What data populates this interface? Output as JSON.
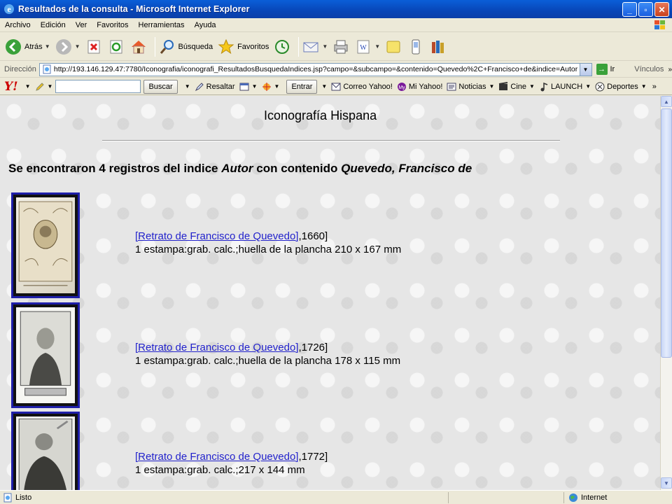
{
  "window": {
    "title": "Resultados de la consulta - Microsoft Internet Explorer"
  },
  "menu": [
    "Archivo",
    "Edición",
    "Ver",
    "Favoritos",
    "Herramientas",
    "Ayuda"
  ],
  "toolbar": {
    "back_label": "Atrás",
    "search_label": "Búsqueda",
    "favorites_label": "Favoritos"
  },
  "address": {
    "label": "Dirección",
    "url": "http://193.146.129.47:7780/Iconografia/iconografi_ResultadosBusquedaIndices.jsp?campo=&subcampo=&contenido=Quevedo%2C+Francisco+de&indice=Autor",
    "go_label": "Ir",
    "links_label": "Vínculos"
  },
  "yahoo": {
    "logo": "Y!",
    "search_button": "Buscar",
    "highlight": "Resaltar",
    "enter": "Entrar",
    "mail": "Correo Yahoo!",
    "my_yahoo": "Mi Yahoo!",
    "news": "Noticias",
    "cinema": "Cine",
    "launch": "LAUNCH",
    "sports": "Deportes"
  },
  "page": {
    "title": "Iconografía Hispana",
    "summary_prefix": "Se encontraron 4 registros del indice ",
    "summary_index": "Autor",
    "summary_mid": " con contenido ",
    "summary_value": "Quevedo, Francisco de",
    "records": [
      {
        "link": "[Retrato de Francisco de Quevedo]",
        "year": ",1660]",
        "desc": "1 estampa:grab. calc.;huella de la plancha 210 x 167 mm"
      },
      {
        "link": "[Retrato de Francisco de Quevedo]",
        "year": ",1726]",
        "desc": "1 estampa:grab. calc.;huella de la plancha 178 x 115 mm"
      },
      {
        "link": "[Retrato de Francisco de Quevedo]",
        "year": ",1772]",
        "desc": "1 estampa:grab. calc.;217 x 144 mm"
      }
    ]
  },
  "status": {
    "text": "Listo",
    "zone": "Internet"
  }
}
